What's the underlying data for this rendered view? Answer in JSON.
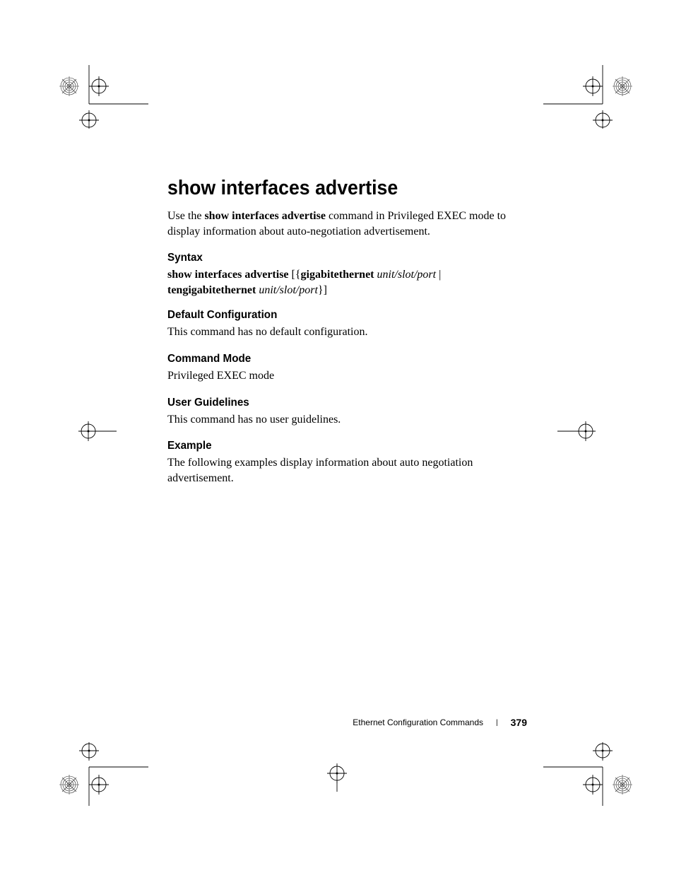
{
  "title": "show interfaces advertise",
  "intro": {
    "pre": "Use the ",
    "cmd": "show interfaces advertise",
    "post": " command in Privileged EXEC mode to display information about auto-negotiation advertisement."
  },
  "sections": {
    "syntax": {
      "heading": "Syntax",
      "line1_cmd": "show interfaces advertise",
      "line1_bracket_open": " [{",
      "line1_kw1": "gigabitethernet",
      "line1_sp": " ",
      "line1_param": "unit/slot/port",
      "line1_pipe": " | ",
      "line2_kw": "tengigabitethernet",
      "line2_sp": " ",
      "line2_param": "unit/slot/port",
      "line2_close": "}]"
    },
    "default_cfg": {
      "heading": "Default Configuration",
      "body": "This command has no default configuration."
    },
    "cmd_mode": {
      "heading": "Command Mode",
      "body": "Privileged EXEC mode"
    },
    "user_guide": {
      "heading": "User Guidelines",
      "body": "This command has no user guidelines."
    },
    "example": {
      "heading": "Example",
      "body": "The following examples display information about auto negotiation advertisement."
    }
  },
  "footer": {
    "chapter": "Ethernet Configuration Commands",
    "page": "379"
  }
}
